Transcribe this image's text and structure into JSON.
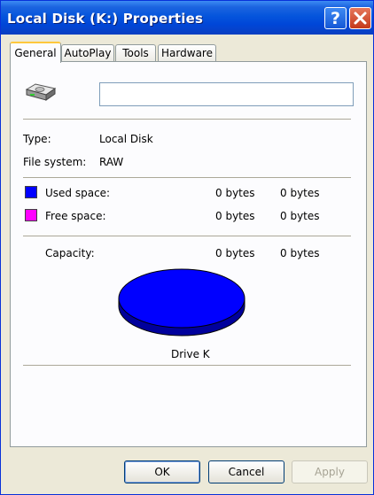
{
  "window": {
    "title": "Local Disk (K:) Properties"
  },
  "tabs": [
    "General",
    "AutoPlay",
    "Tools",
    "Hardware"
  ],
  "general": {
    "name_value": "",
    "type_label": "Type:",
    "type_value": "Local Disk",
    "fs_label": "File system:",
    "fs_value": "RAW",
    "used_label": "Used space:",
    "used_bytes": "0 bytes",
    "used_size": "0 bytes",
    "free_label": "Free space:",
    "free_bytes": "0 bytes",
    "free_size": "0 bytes",
    "capacity_label": "Capacity:",
    "capacity_bytes": "0 bytes",
    "capacity_size": "0 bytes",
    "drive_label": "Drive K"
  },
  "colors": {
    "used": "#0000ff",
    "free": "#ff00ff"
  },
  "buttons": {
    "ok": "OK",
    "cancel": "Cancel",
    "apply": "Apply"
  }
}
